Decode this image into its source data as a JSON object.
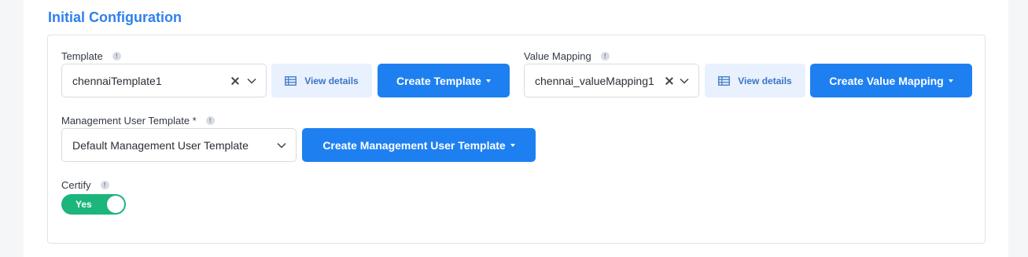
{
  "section": {
    "title": "Initial Configuration"
  },
  "template": {
    "label": "Template",
    "value": "chennaiTemplate1",
    "view_details": "View details",
    "create_label": "Create Template"
  },
  "value_mapping": {
    "label": "Value Mapping",
    "value": "chennai_valueMapping1",
    "view_details": "View details",
    "create_label": "Create Value Mapping"
  },
  "management_user_template": {
    "label": "Management User Template *",
    "value": "Default Management User Template",
    "create_label": "Create Management User Template"
  },
  "certify": {
    "label": "Certify",
    "toggle_text": "Yes",
    "on": true
  },
  "info_glyph": "!",
  "colors": {
    "accent": "#1e80f0",
    "title": "#2f80ed",
    "toggle_on": "#1cb57c",
    "light_button": "#e8f1fd"
  }
}
